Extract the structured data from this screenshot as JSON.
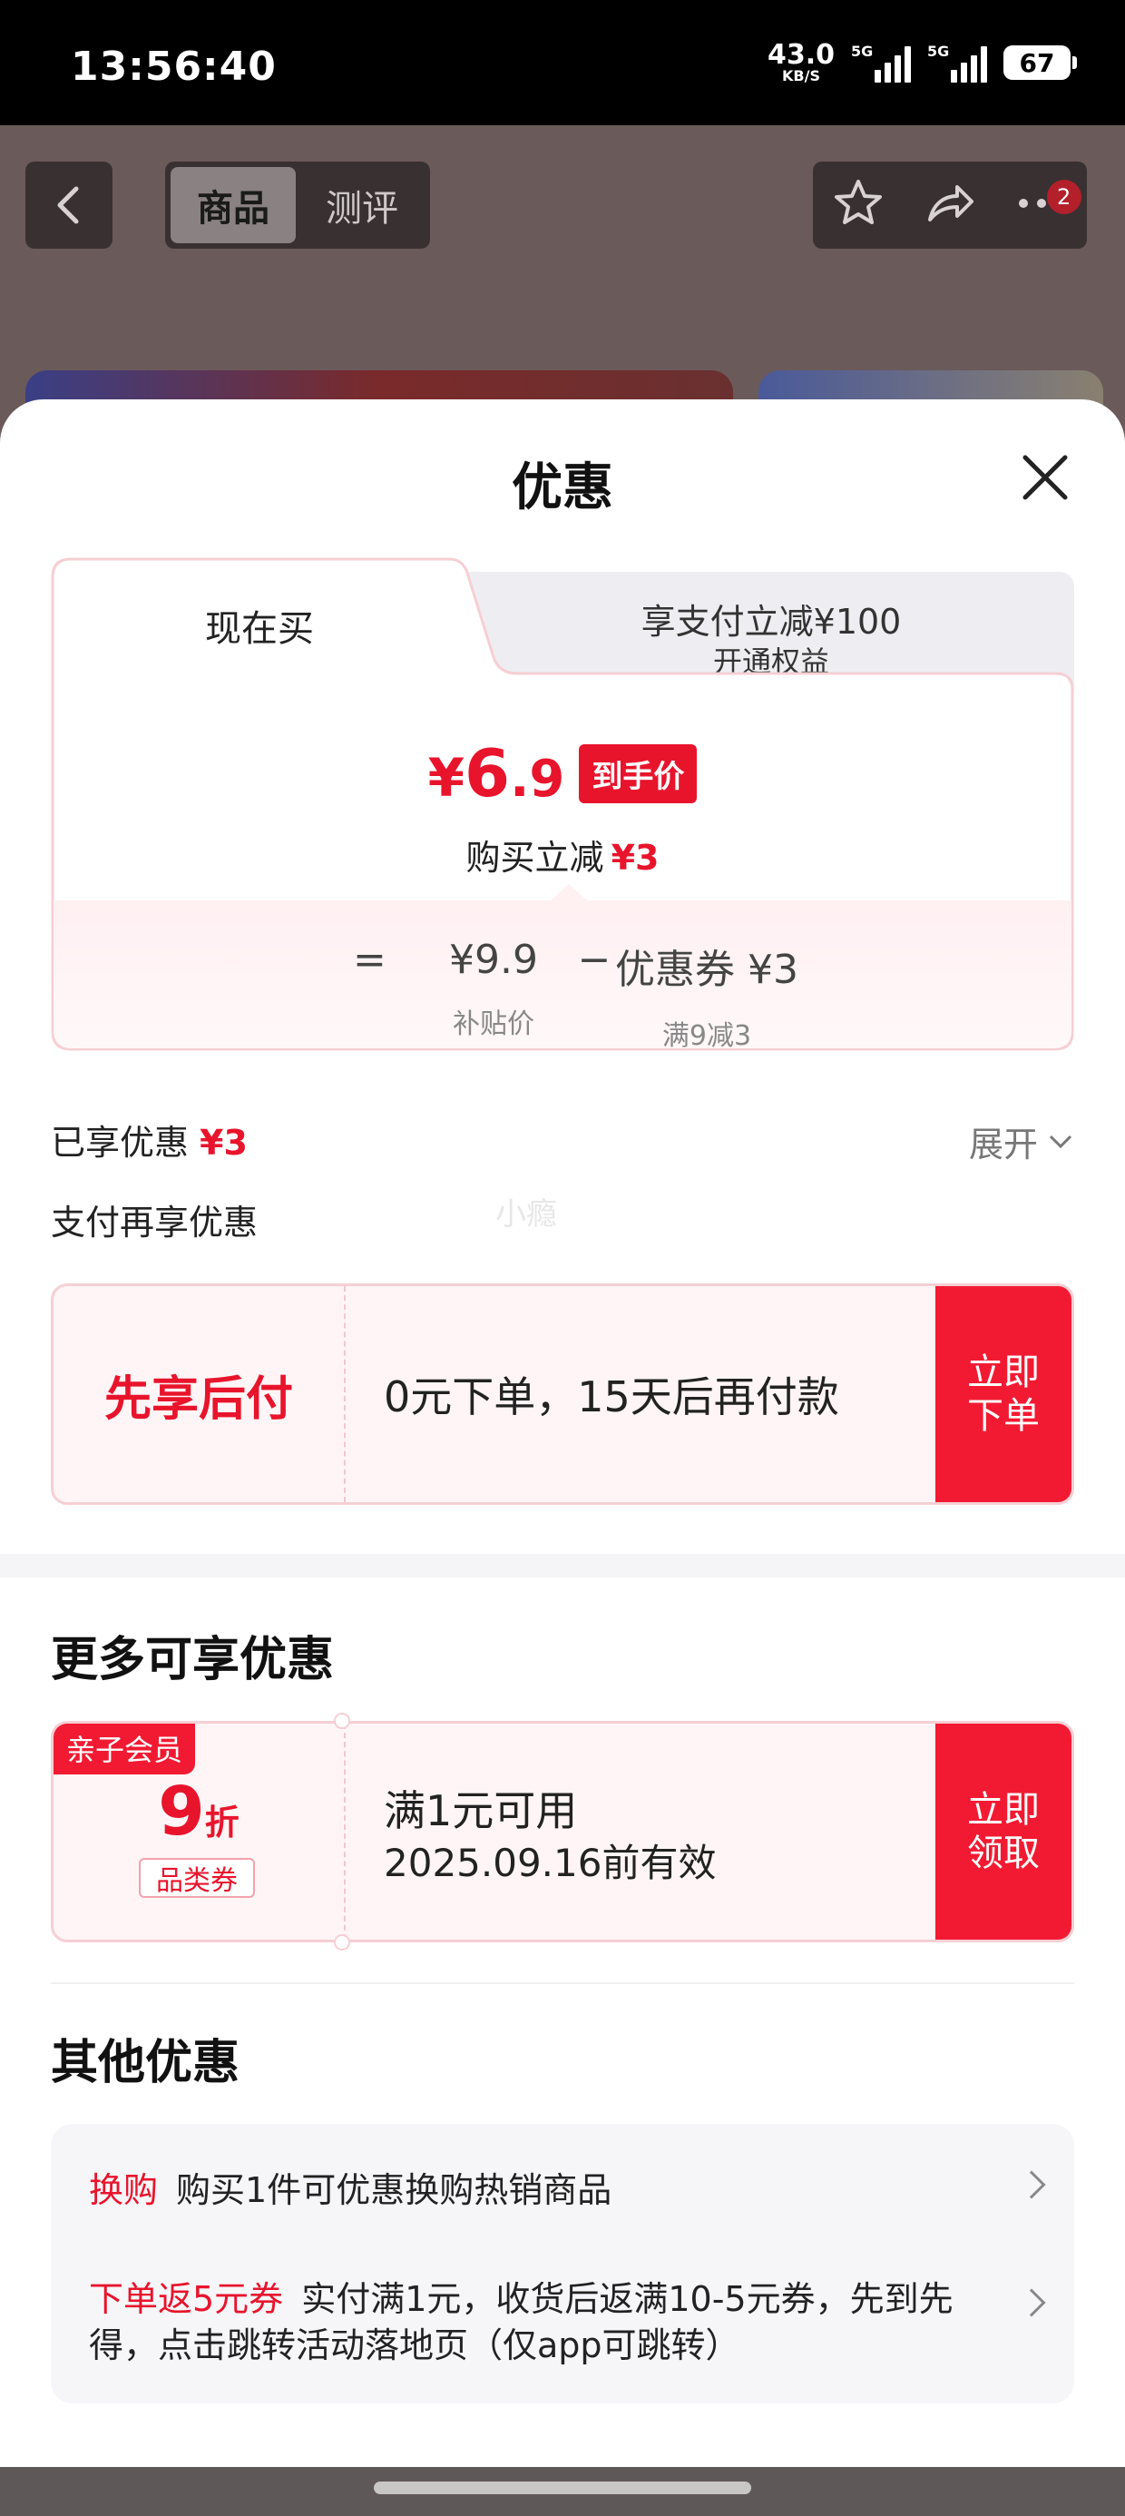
{
  "status_bar": {
    "time": "13:56:40",
    "net_speed": "43.0",
    "net_speed_unit": "KB/S",
    "signal1_label": "5G",
    "signal2_label": "5G",
    "battery": "67"
  },
  "background_page": {
    "tabs": [
      {
        "label": "商品",
        "active": true
      },
      {
        "label": "测评",
        "active": false
      }
    ],
    "cart_badge": "2",
    "icons": [
      "back-icon",
      "star-icon",
      "share-icon",
      "more-icon"
    ]
  },
  "sheet": {
    "title": "优惠",
    "price_card": {
      "tab_now": "现在买",
      "tab_pay_title": "享支付立减¥100",
      "tab_pay_sub": "开通权益",
      "price_yen": "¥",
      "price_int": "6",
      "price_dec": ".9",
      "price_tag": "到手价",
      "discount_label": "购买立减",
      "discount_amount": "¥3",
      "calc": {
        "eq": "=",
        "subsidy_price": "¥9.9",
        "minus": "−",
        "coupon": "优惠券 ¥3",
        "subsidy_label": "补贴价",
        "coupon_rule": "满9减3"
      }
    },
    "enjoyed_label": "已享优惠",
    "enjoyed_amount": "¥3",
    "expand_label": "展开",
    "pay_more_label": "支付再享优惠",
    "watermark": "小瘾",
    "pay_later": {
      "title": "先享后付",
      "desc": "0元下单，15天后再付款",
      "cta": "立即下单"
    },
    "more_title": "更多可享优惠",
    "coupon": {
      "tag": "亲子会员",
      "discount": "9",
      "discount_unit": "折",
      "category": "品类券",
      "condition": "满1元可用",
      "valid": "2025.09.16前有效",
      "cta": "立即领取"
    },
    "other_title": "其他优惠",
    "other_items": [
      {
        "highlight": "换购",
        "text": "购买1件可优惠换购热销商品"
      },
      {
        "highlight": "下单返5元券",
        "text": "实付满1元，收货后返满10-5元券，先到先得，点击跳转活动落地页（仅app可跳转）"
      }
    ]
  },
  "colors": {
    "accent": "#e8142c",
    "cta": "#f21a32",
    "card_border": "#f5cfd4",
    "card_bg": "#fff5f6"
  }
}
